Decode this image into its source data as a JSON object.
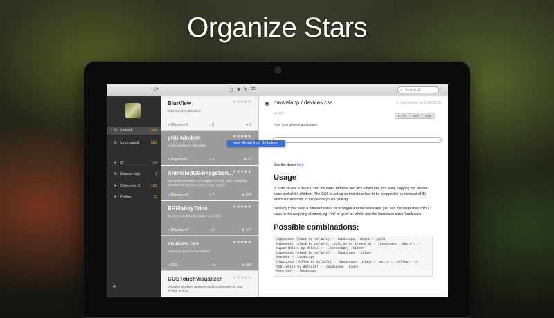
{
  "hero": {
    "title": "Organize Stars"
  },
  "toolbar": {
    "search_placeholder": "Search All"
  },
  "sidebar": {
    "groups": [
      {
        "label": "Stared",
        "count": "1300",
        "icon": "star-icon",
        "selected": true
      },
      {
        "label": "Ungrouped",
        "count": "583",
        "icon": "ungrouped-icon",
        "selected": false
      }
    ],
    "languages": [
      {
        "label": "C",
        "count": "24"
      },
      {
        "label": "Emacs Lisp",
        "count": "1"
      },
      {
        "label": "Objective-C",
        "count": "1102"
      },
      {
        "label": "Python",
        "count": "10"
      }
    ]
  },
  "repos": [
    {
      "name": "BlurView",
      "desc": "OSX real time BlurView",
      "lang": "Objective-C",
      "forks": "0",
      "stars": "2",
      "selected": false
    },
    {
      "name": "grid-window",
      "desc": "A grid overlay for iOS apps.",
      "lang": "Objective-C",
      "forks": "3",
      "stars": "91",
      "selected": true
    },
    {
      "name": "AnimatedGIFImageSeri...",
      "desc": "Complete Animated GIF Support for iOS, with Functions, NSJSONSerialization-style Class, and (...",
      "lang": "Objective-C",
      "forks": "7",
      "stars": "263",
      "selected": true
    },
    {
      "name": "BRFlabbyTable",
      "desc": "Bouncy and distorded table view cells",
      "lang": "Objective-C",
      "forks": "5",
      "stars": "137",
      "selected": true
    },
    {
      "name": "devices.css",
      "desc": "Pure CSS phones and tablets",
      "lang": "CSS",
      "forks": "41",
      "stars": "680",
      "selected": true
    },
    {
      "name": "COSTouchVisualizer",
      "desc": "Visualize touches, gestures and long presses on your iPhone or iPad",
      "lang": "",
      "forks": "",
      "stars": "",
      "selected": false
    }
  ],
  "context_menu": {
    "label": "New Group from Selection"
  },
  "detail": {
    "title": "marvelapp / devices.css",
    "pushed": "Last pushed at 2014-03-25",
    "built_by": "built by",
    "clone_tabs": [
      "HTTP",
      "SSH",
      "SVN"
    ],
    "description": "Pure CSS phones and tablets",
    "see_demo": "See the demo",
    "demo_link": "here",
    "usage_heading": "Usage",
    "usage_p1": "In order to use a device, visit the index.html file and pick which one you want, copying the 'device' class and all it's children. The CSS is set up so that class has to be wrapped in an element of ID which corresponds to the device you're picking.",
    "usage_p2": "Similarly if you want a different colour or to toggle it to be landscape, just add the respective colour class to the wrapping element, eg. 'red' or 'gold' or 'white' and the landscape class 'landscape'.",
    "combos_heading": "Possible combinations:",
    "code": "#iphone5s (black by default) - .landscape, .white + .gold\n#iphone5c (black by default, could be an iPhone 5) - .landscape, .white + .r\n#ipad (black by default) - .landscape, .silver\n#iphone4s (black by default) - .landscape, .silver\n#nexus5 - .landscape\n#lumia920 (yellow by default) - .landscape, .black + .white + .yellow + .r\n#s5 (white by default) - .landscape, .black\n#htc-one - .landscape"
  }
}
